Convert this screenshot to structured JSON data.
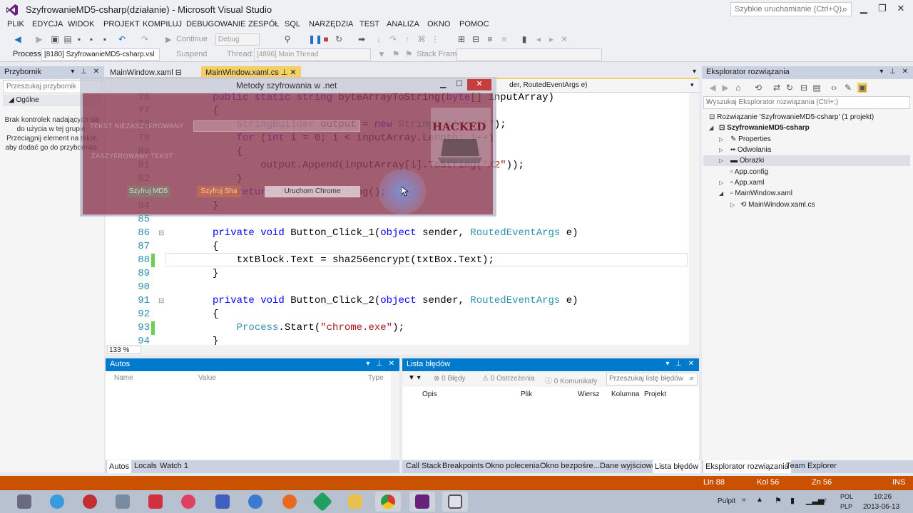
{
  "window": {
    "title": "SzyfrowanieMD5-csharp(działanie) - Microsoft Visual Studio",
    "quick_launch_placeholder": "Szybkie uruchamianie (Ctrl+Q)"
  },
  "menu": [
    "PLIK",
    "EDYCJA",
    "WIDOK",
    "PROJEKT",
    "KOMPILUJ",
    "DEBUGOWANIE",
    "ZESPÓŁ",
    "SQL",
    "NARZĘDZIA",
    "TEST",
    "ANALIZA",
    "OKNO",
    "POMOC"
  ],
  "toolbar": {
    "continue_label": "Continue",
    "debug_config": "Debug",
    "process_label": "Process:",
    "process_value": "[8180] SzyfrowanieMD5-csharp.vsl",
    "suspend_label": "Suspend",
    "thread_label": "Thread:",
    "thread_value": "[4896] Main Thread",
    "stack_frame_label": "Stack Frame:"
  },
  "toolbox": {
    "title": "Przybornik",
    "search_placeholder": "Przeszukaj przybornik",
    "group": "Ogólne",
    "empty_text": "Brak kontrolek nadających się do użycia w tej grupie. Przeciągnij element na tekst, aby dodać go do przybornika."
  },
  "editor": {
    "tabs": [
      {
        "label": "MainWindow.xaml",
        "active": false
      },
      {
        "label": "MainWindow.xaml.cs",
        "active": true
      }
    ],
    "nav_right": "der, RoutedEventArgs e)",
    "zoom": "133 %",
    "lines": [
      {
        "n": "76",
        "text": "public static string byteArrayToString(byte[] inputArray)"
      },
      {
        "n": "77",
        "text": "{"
      },
      {
        "n": "78",
        "text": "    StringBuilder output = new StringBuilder(\"\");"
      },
      {
        "n": "79",
        "text": "    for (int i = 0; i < inputArray.Length; i++)"
      },
      {
        "n": "80",
        "text": "    {"
      },
      {
        "n": "81",
        "text": "        output.Append(inputArray[i].ToString(\"X2\"));"
      },
      {
        "n": "82",
        "text": "    }"
      },
      {
        "n": "83",
        "text": "    return output.ToString();"
      },
      {
        "n": "84",
        "text": "}"
      },
      {
        "n": "85",
        "text": ""
      },
      {
        "n": "86",
        "text": "private void Button_Click_1(object sender, RoutedEventArgs e)"
      },
      {
        "n": "87",
        "text": "{"
      },
      {
        "n": "88",
        "text": "    txtBlock.Text = sha256encrypt(txtBox.Text);"
      },
      {
        "n": "89",
        "text": "}"
      },
      {
        "n": "90",
        "text": ""
      },
      {
        "n": "91",
        "text": "private void Button_Click_2(object sender, RoutedEventArgs e)"
      },
      {
        "n": "92",
        "text": "{"
      },
      {
        "n": "93",
        "text": "    Process.Start(\"chrome.exe\");"
      },
      {
        "n": "94",
        "text": "}"
      }
    ]
  },
  "dialog": {
    "title": "Metody szyfrowania w .net",
    "label_plain": "TEKST NIEZASZYFROWANY",
    "label_encrypted": "ZASZYFROWANY TEKST",
    "btn_md5": "Szyfruj MD5",
    "btn_sha": "Szyfruj Sha",
    "btn_chrome": "Uruchom Chrome",
    "image_text": "HACKED"
  },
  "solution_explorer": {
    "title": "Eksplorator rozwiązania",
    "search_placeholder": "Wyszukaj Eksplorator rozwiązania (Ctrl+;)",
    "items": [
      {
        "label": "Rozwiązanie 'SzyfrowanieMD5-csharp' (1 projekt)"
      },
      {
        "label": "SzyfrowanieMD5-csharp"
      },
      {
        "label": "Properties"
      },
      {
        "label": "Odwołania"
      },
      {
        "label": "Obrazki"
      },
      {
        "label": "App.config"
      },
      {
        "label": "App.xaml"
      },
      {
        "label": "MainWindow.xaml"
      },
      {
        "label": "MainWindow.xaml.cs"
      }
    ]
  },
  "autos": {
    "title": "Autos",
    "columns": [
      "Name",
      "Value",
      "Type"
    ],
    "tabs": [
      "Autos",
      "Locals",
      "Watch 1"
    ]
  },
  "errors": {
    "title": "Lista błędów",
    "errors_btn": "0 Błędy",
    "warnings_btn": "0 Ostrzeżenia",
    "messages_btn": "0 Komunikaty",
    "search_placeholder": "Przeszukaj listę błędów",
    "columns": [
      "Opis",
      "Plik",
      "Wiersz",
      "Kolumna",
      "Projekt"
    ],
    "tabs": [
      "Call Stack",
      "Breakpoints",
      "Okno polecenia",
      "Okno bezpośre...",
      "Dane wyjściowe",
      "Lista błędów"
    ]
  },
  "right_tabs": [
    "Eksplorator rozwiązania",
    "Team Explorer"
  ],
  "status": {
    "line": "Lin 88",
    "col": "Kol 56",
    "ch": "Zn 56",
    "mode": "INS"
  },
  "taskbar": {
    "desktop": "Pulpit",
    "lang1": "POL",
    "lang2": "PLP",
    "time": "10:26",
    "date": "2013-06-13"
  }
}
